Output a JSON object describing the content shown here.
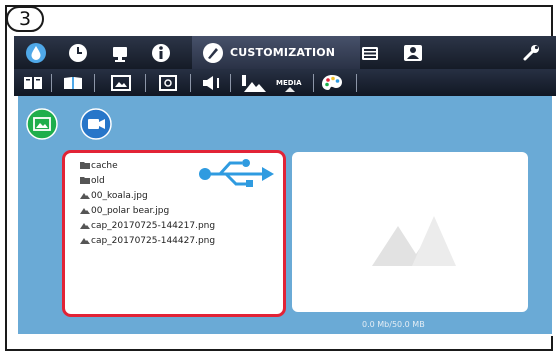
{
  "step_badge": "3",
  "topbar": {
    "items": [
      {
        "icon": "droplet-icon"
      },
      {
        "icon": "clock-icon"
      },
      {
        "icon": "monitor-icon"
      },
      {
        "icon": "info-icon"
      },
      {
        "icon": "brush-icon",
        "label": "CUSTOMIZATION",
        "active": true
      },
      {
        "icon": "keyboard-icon"
      },
      {
        "icon": "user-admin-icon"
      },
      {
        "icon": "wrench-icon"
      }
    ]
  },
  "subbar": {
    "items": [
      {
        "icon": "book-icon"
      },
      {
        "icon": "open-book-icon"
      },
      {
        "icon": "slideshow-icon"
      },
      {
        "icon": "photo-frame-icon"
      },
      {
        "icon": "speaker-icon"
      },
      {
        "icon": "media-icon",
        "label": "MEDIA",
        "active": true
      },
      {
        "icon": "palette-icon"
      }
    ]
  },
  "media": {
    "modes": [
      {
        "name": "image",
        "icon": "image-icon",
        "active": true
      },
      {
        "name": "video",
        "icon": "video-camera-icon",
        "active": false
      }
    ],
    "files": [
      {
        "type": "folder",
        "name": "cache"
      },
      {
        "type": "folder",
        "name": "old"
      },
      {
        "type": "image",
        "name": "00_koala.jpg"
      },
      {
        "type": "image",
        "name": "00_polar bear.jpg"
      },
      {
        "type": "image",
        "name": "cap_20170725-144217.png"
      },
      {
        "type": "image",
        "name": "cap_20170725-144427.png"
      }
    ],
    "usb_icon": "usb-icon",
    "preview_icon": "image-placeholder-icon",
    "storage": "0.0 Mb/50.0 MB"
  },
  "colors": {
    "panel": "#6aaad6",
    "highlight": "#e22336",
    "usb": "#2f9be0",
    "image_mode": "#1eae4c",
    "video_mode": "#2776c9"
  }
}
